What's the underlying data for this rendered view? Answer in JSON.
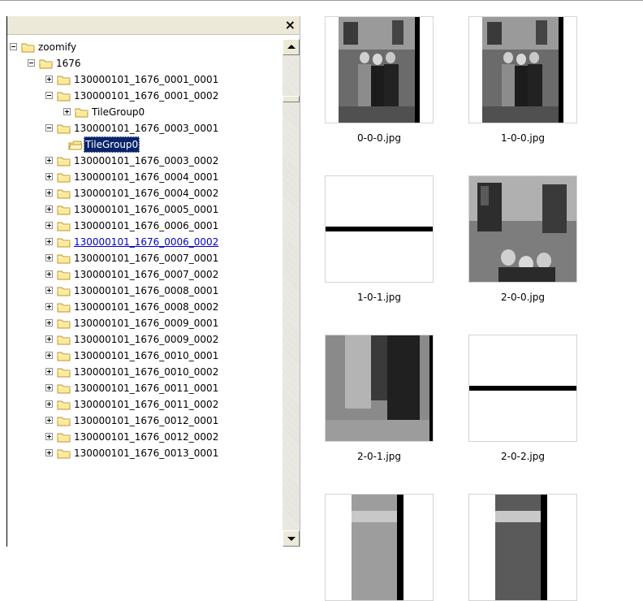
{
  "panel": {
    "close_glyph": "×"
  },
  "tree": {
    "root": "zoomify",
    "level1": "1676",
    "items": [
      {
        "label": "130000101_1676_0001_0001",
        "expanded": false
      },
      {
        "label": "130000101_1676_0001_0002",
        "expanded": true,
        "children": [
          {
            "label": "TileGroup0",
            "expanded": false
          }
        ]
      },
      {
        "label": "130000101_1676_0003_0001",
        "expanded": true,
        "children": [
          {
            "label": "TileGroup0",
            "selected": true
          }
        ]
      },
      {
        "label": "130000101_1676_0003_0002"
      },
      {
        "label": "130000101_1676_0004_0001"
      },
      {
        "label": "130000101_1676_0004_0002"
      },
      {
        "label": "130000101_1676_0005_0001"
      },
      {
        "label": "130000101_1676_0006_0001"
      },
      {
        "label": "130000101_1676_0006_0002",
        "hover": true
      },
      {
        "label": "130000101_1676_0007_0001"
      },
      {
        "label": "130000101_1676_0007_0002"
      },
      {
        "label": "130000101_1676_0008_0001"
      },
      {
        "label": "130000101_1676_0008_0002"
      },
      {
        "label": "130000101_1676_0009_0001"
      },
      {
        "label": "130000101_1676_0009_0002"
      },
      {
        "label": "130000101_1676_0010_0001"
      },
      {
        "label": "130000101_1676_0010_0002"
      },
      {
        "label": "130000101_1676_0011_0001"
      },
      {
        "label": "130000101_1676_0011_0002"
      },
      {
        "label": "130000101_1676_0012_0001"
      },
      {
        "label": "130000101_1676_0012_0002"
      },
      {
        "label": "130000101_1676_0013_0001"
      }
    ]
  },
  "files": [
    {
      "name": "0-0-0.jpg",
      "kind": "photo-group"
    },
    {
      "name": "1-0-0.jpg",
      "kind": "photo-group"
    },
    {
      "name": "1-0-1.jpg",
      "kind": "black-strip"
    },
    {
      "name": "2-0-0.jpg",
      "kind": "photo-closeup"
    },
    {
      "name": "2-0-1.jpg",
      "kind": "photo-lower"
    },
    {
      "name": "2-0-2.jpg",
      "kind": "black-strip"
    },
    {
      "name": "",
      "kind": "photo-narrow"
    },
    {
      "name": "",
      "kind": "photo-narrow-dark"
    }
  ],
  "colors": {
    "folder_fill": "#fde99a",
    "folder_stroke": "#b89a2c",
    "selection": "#0a246a",
    "link": "#0000cc"
  },
  "icons": {
    "folder": "folder-icon",
    "expand": "plus-box-icon",
    "collapse": "minus-box-icon",
    "close": "close-icon"
  }
}
